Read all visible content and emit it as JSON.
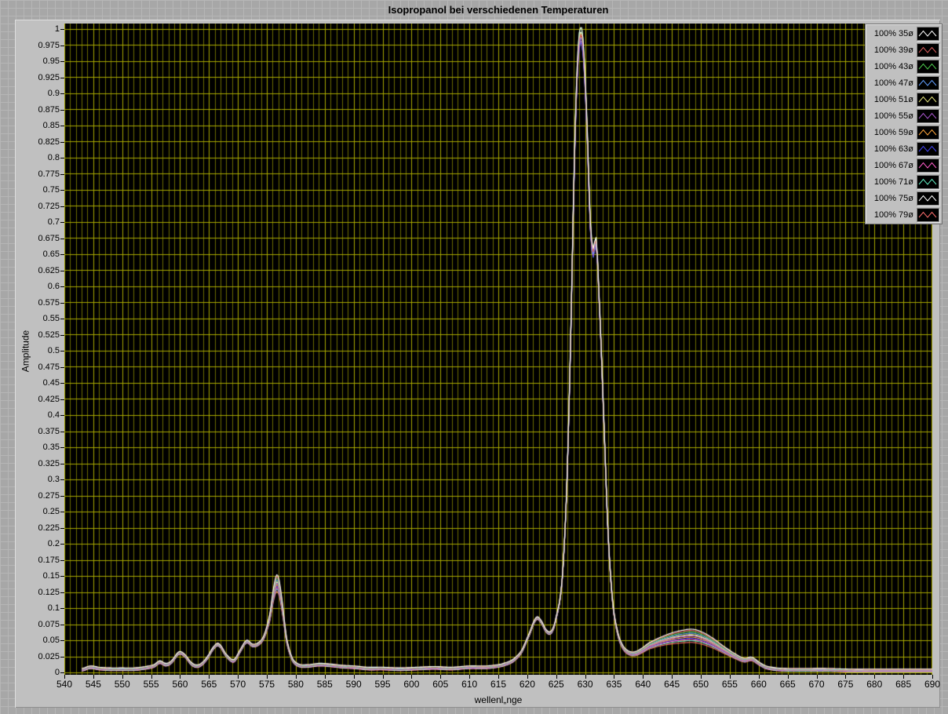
{
  "window": {
    "background_base": "#a7a7a7",
    "background_grid_line": "#b6b6b6",
    "panel_color": "#c0c0c0"
  },
  "chart_data": {
    "type": "line",
    "title": "Isopropanol bei verschiedenen Temperaturen",
    "xlabel": "wellenl„nge",
    "ylabel": "Amplitude",
    "plot_bg": "#000000",
    "grid_minor_color": "#6b6b00",
    "grid_major_color": "#a8a800",
    "grid": "on",
    "legend_position": "top-right",
    "x_axis": {
      "min": 540,
      "max": 690,
      "major_step": 5,
      "minor_step": 1
    },
    "y_axis": {
      "min": 0,
      "max": 1,
      "major_step": 0.025
    },
    "x_tick_labels": [
      540,
      545,
      550,
      555,
      560,
      565,
      570,
      575,
      580,
      585,
      590,
      595,
      600,
      605,
      610,
      615,
      620,
      625,
      630,
      635,
      640,
      645,
      650,
      655,
      660,
      665,
      670,
      675,
      680,
      685,
      690
    ],
    "y_tick_labels": [
      1,
      0.975,
      0.95,
      0.925,
      0.9,
      0.875,
      0.85,
      0.825,
      0.8,
      0.775,
      0.75,
      0.725,
      0.7,
      0.675,
      0.65,
      0.625,
      0.6,
      0.575,
      0.55,
      0.525,
      0.5,
      0.475,
      0.45,
      0.425,
      0.4,
      0.375,
      0.35,
      0.325,
      0.3,
      0.275,
      0.25,
      0.225,
      0.2,
      0.175,
      0.15,
      0.125,
      0.1,
      0.075,
      0.05,
      0.025,
      0
    ],
    "series": [
      {
        "name": "100% 35ø",
        "color": "#ffffff",
        "hump_factor": 1.14,
        "peak_factor": 1.0
      },
      {
        "name": "100% 39ø",
        "color": "#db5c5c",
        "hump_factor": 1.11,
        "peak_factor": 0.988
      },
      {
        "name": "100% 43ø",
        "color": "#4dc94d",
        "hump_factor": 1.08,
        "peak_factor": 1.0
      },
      {
        "name": "100% 47ø",
        "color": "#629fff",
        "hump_factor": 1.05,
        "peak_factor": 0.984
      },
      {
        "name": "100% 51ø",
        "color": "#e2e27a",
        "hump_factor": 1.02,
        "peak_factor": 0.992
      },
      {
        "name": "100% 55ø",
        "color": "#a855cc",
        "hump_factor": 0.99,
        "peak_factor": 0.98
      },
      {
        "name": "100% 59ø",
        "color": "#ffa63c",
        "hump_factor": 0.965,
        "peak_factor": 0.99
      },
      {
        "name": "100% 63ø",
        "color": "#4343f0",
        "hump_factor": 0.94,
        "peak_factor": 0.978
      },
      {
        "name": "100% 67ø",
        "color": "#ff5cc8",
        "hump_factor": 0.915,
        "peak_factor": 0.986
      },
      {
        "name": "100% 71ø",
        "color": "#63eec3",
        "hump_factor": 0.89,
        "peak_factor": 0.982
      },
      {
        "name": "100% 75ø",
        "color": "#ffffff",
        "hump_factor": 1.045,
        "peak_factor": 0.996
      },
      {
        "name": "100% 79ø",
        "color": "#ff6e6e",
        "hump_factor": 0.855,
        "peak_factor": 0.99
      }
    ],
    "base_points": [
      [
        543,
        0.004
      ],
      [
        544.5,
        0.008
      ],
      [
        546,
        0.006
      ],
      [
        548,
        0.005
      ],
      [
        550,
        0.005
      ],
      [
        552,
        0.005
      ],
      [
        554,
        0.007
      ],
      [
        555.5,
        0.01
      ],
      [
        556.5,
        0.016
      ],
      [
        557.5,
        0.012
      ],
      [
        558.5,
        0.016
      ],
      [
        559.8,
        0.03
      ],
      [
        560.8,
        0.026
      ],
      [
        562,
        0.013
      ],
      [
        563.2,
        0.01
      ],
      [
        564.5,
        0.02
      ],
      [
        566,
        0.04
      ],
      [
        566.8,
        0.042
      ],
      [
        568,
        0.026
      ],
      [
        569.3,
        0.018
      ],
      [
        570.5,
        0.035
      ],
      [
        571.5,
        0.048
      ],
      [
        572.5,
        0.042
      ],
      [
        573.5,
        0.044
      ],
      [
        574.5,
        0.055
      ],
      [
        575.5,
        0.085
      ],
      [
        576.3,
        0.128
      ],
      [
        576.9,
        0.138
      ],
      [
        577.6,
        0.105
      ],
      [
        578.4,
        0.05
      ],
      [
        579.4,
        0.02
      ],
      [
        580.5,
        0.011
      ],
      [
        582,
        0.01
      ],
      [
        584,
        0.012
      ],
      [
        586,
        0.011
      ],
      [
        588,
        0.009
      ],
      [
        590,
        0.008
      ],
      [
        592.5,
        0.006
      ],
      [
        595,
        0.006
      ],
      [
        598,
        0.005
      ],
      [
        601,
        0.006
      ],
      [
        604,
        0.007
      ],
      [
        607,
        0.006
      ],
      [
        610,
        0.008
      ],
      [
        613,
        0.008
      ],
      [
        615.5,
        0.011
      ],
      [
        617.5,
        0.018
      ],
      [
        619,
        0.032
      ],
      [
        620.3,
        0.058
      ],
      [
        621.5,
        0.083
      ],
      [
        622.3,
        0.08
      ],
      [
        623.3,
        0.064
      ],
      [
        624.2,
        0.063
      ],
      [
        625,
        0.085
      ],
      [
        626,
        0.14
      ],
      [
        626.8,
        0.28
      ],
      [
        627.5,
        0.52
      ],
      [
        628.2,
        0.82
      ],
      [
        628.8,
        0.97
      ],
      [
        629.4,
        1.0
      ],
      [
        629.9,
        0.945
      ],
      [
        630.4,
        0.835
      ],
      [
        630.9,
        0.7
      ],
      [
        631.4,
        0.655
      ],
      [
        631.9,
        0.672
      ],
      [
        632.4,
        0.585
      ],
      [
        633.2,
        0.4
      ],
      [
        634,
        0.21
      ],
      [
        634.8,
        0.105
      ],
      [
        635.7,
        0.058
      ],
      [
        636.6,
        0.038
      ],
      [
        637.6,
        0.03
      ],
      [
        638.6,
        0.029
      ],
      [
        639.6,
        0.033
      ],
      [
        641,
        0.041
      ],
      [
        643,
        0.048
      ],
      [
        645,
        0.053
      ],
      [
        647,
        0.056
      ],
      [
        648.5,
        0.057
      ],
      [
        650,
        0.054
      ],
      [
        652,
        0.046
      ],
      [
        654,
        0.035
      ],
      [
        656,
        0.025
      ],
      [
        657.5,
        0.019
      ],
      [
        658.8,
        0.021
      ],
      [
        660,
        0.014
      ],
      [
        661.2,
        0.008
      ],
      [
        663,
        0.005
      ],
      [
        665,
        0.004
      ],
      [
        668,
        0.004
      ],
      [
        672,
        0.004
      ],
      [
        676,
        0.003
      ],
      [
        680,
        0.003
      ],
      [
        684,
        0.003
      ],
      [
        687,
        0.003
      ],
      [
        690,
        0.003
      ]
    ]
  }
}
